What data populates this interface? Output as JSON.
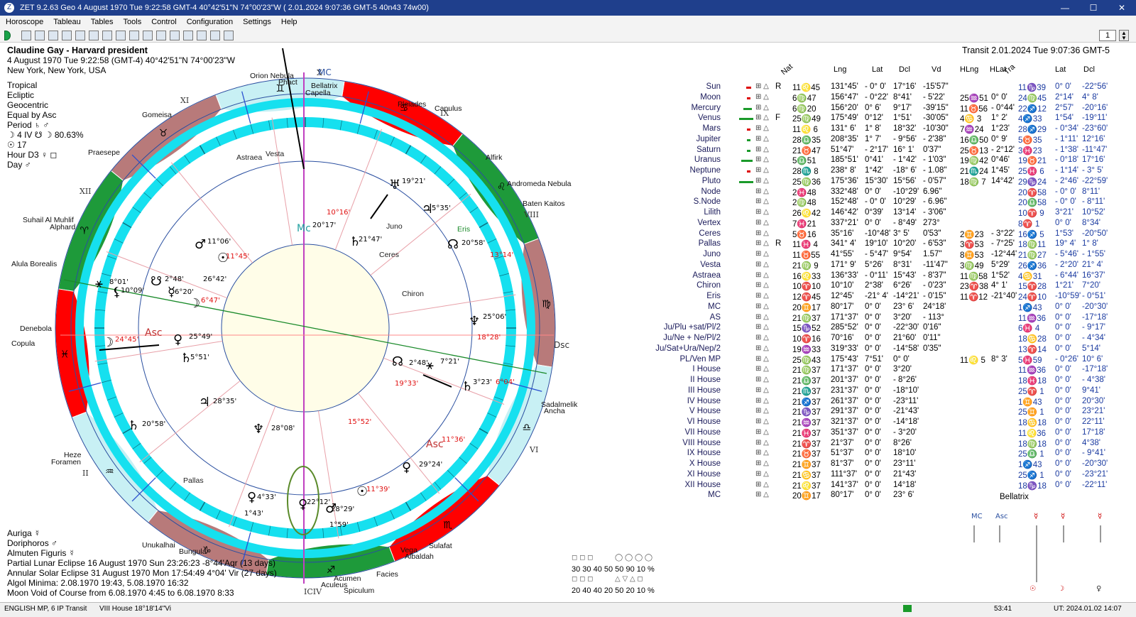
{
  "window": {
    "title": "ZET 9.2.63 Geo    4 August 1970  Tue  9:22:58 GMT-4 40°42'51\"N  74°00'23\"W  ( 2.01.2024   9:07:36 GMT-5 40n43 74w00)"
  },
  "menu": [
    "Horoscope",
    "Tableau",
    "Tables",
    "Tools",
    "Control",
    "Configuration",
    "Settings",
    "Help"
  ],
  "toolbar": {
    "spinner_value": "1"
  },
  "header_left": {
    "name": "Claudine Gay - Harvard president",
    "line2": "4 August 1970  Tue   9:22:58 (GMT-4) 40°42'51\"N  74°00'23\"W",
    "line3": "New York, New York, USA"
  },
  "settings_left": [
    "Tropical",
    "Ecliptic",
    "Geocentric",
    "Equal by Asc",
    "Period  ♄ ♂",
    "☽  4 IV  ☋ ☽ 80.63%",
    "☉  17",
    "Hour D3  ♀ ◻",
    "Day  ♂"
  ],
  "transit_header": "Transit  2.01.2024  Tue  9:07:36 GMT-5",
  "column_headers": {
    "nat": "Nat",
    "lng": "Lng",
    "lat": "Lat",
    "dcl": "Dcl",
    "vd": "Vd",
    "hlng": "HLng",
    "hlat": "HLat",
    "tra": "Tra",
    "tlat": "Lat",
    "tdcl": "Dcl"
  },
  "planets": [
    {
      "name": "Sun",
      "r": "R",
      "pos": "11♌45",
      "lng": "131°45'",
      "lat": "- 0° 0'",
      "dcl": "17°16'",
      "vd": "-15'57\"",
      "hlng": "",
      "hlat": "",
      "tpos": "11♑39",
      "tlat": "0° 0'",
      "tdcl": "-22°56'",
      "bar": "#d00",
      "barw": 18
    },
    {
      "name": "Moon",
      "r": "",
      "pos": "6♍47",
      "lng": "156°47'",
      "lat": "- 0°22'",
      "dcl": "8°41'",
      "vd": "- 5'22'",
      "hlng": "25♒51",
      "hlat": "0° 0'",
      "tpos": "24♍45",
      "tlat": "2°14'",
      "tdcl": "4° 8'",
      "bar": "#d00",
      "barw": 14
    },
    {
      "name": "Mercury",
      "r": "",
      "pos": "6♍20",
      "lng": "156°20'",
      "lat": "0° 6'",
      "dcl": "9°17'",
      "vd": "-39'15\"",
      "hlng": "11♉56",
      "hlat": "- 0°44'",
      "tpos": "22♐12",
      "tlat": "2°57'",
      "tdcl": "-20°16'",
      "bar": "#1a9a2a",
      "barw": 30
    },
    {
      "name": "Venus",
      "r": "F",
      "pos": "25♍49",
      "lng": "175°49'",
      "lat": "0°12'",
      "dcl": "1°51'",
      "vd": "-30'05\"",
      "hlng": "4♋ 3",
      "hlat": "1° 2'",
      "tpos": "4♐33",
      "tlat": "1°54'",
      "tdcl": "-19°11'",
      "bar": "#1a9a2a",
      "barw": 50
    },
    {
      "name": "Mars",
      "r": "",
      "pos": "11♌ 6",
      "lng": "131° 6'",
      "lat": "1° 8'",
      "dcl": "18°32'",
      "vd": "-10'30\"",
      "hlng": "7♒24",
      "hlat": "1°23'",
      "tpos": "28♐29",
      "tlat": "- 0°34'",
      "tdcl": "-23°60'",
      "bar": "#d00",
      "barw": 14
    },
    {
      "name": "Jupiter",
      "r": "",
      "pos": "28♎35",
      "lng": "208°35'",
      "lat": "1° 7'",
      "dcl": "- 9°56'",
      "vd": "- 2'38\"",
      "hlng": "16♎50",
      "hlat": "0° 9'",
      "tpos": "5♉35",
      "tlat": "- 1°11'",
      "tdcl": "12°16'",
      "bar": "#1a9a2a",
      "barw": 14
    },
    {
      "name": "Saturn",
      "r": "",
      "pos": "21♉47",
      "lng": "51°47'",
      "lat": "- 2°17'",
      "dcl": "16° 1'",
      "vd": "0'37\"",
      "hlng": "25♉13",
      "hlat": "- 2°12'",
      "tpos": "3♓23",
      "tlat": "- 1°38'",
      "tdcl": "-11°47'",
      "bar": "#1a9a2a",
      "barw": 14
    },
    {
      "name": "Uranus",
      "r": "",
      "pos": "5♎51",
      "lng": "185°51'",
      "lat": "0°41'",
      "dcl": "- 1°42'",
      "vd": "- 1'03\"",
      "hlng": "19♍42",
      "hlat": "0°46'",
      "tpos": "19♉21",
      "tlat": "- 0°18'",
      "tdcl": "17°16'",
      "bar": "#1a9a2a",
      "barw": 40
    },
    {
      "name": "Neptune",
      "r": "",
      "pos": "28♏ 8",
      "lng": "238° 8'",
      "lat": "1°42'",
      "dcl": "-18° 6'",
      "vd": "- 1.08\"",
      "hlng": "21♏24",
      "hlat": "1°45'",
      "tpos": "25♓ 6",
      "tlat": "- 1°14'",
      "tdcl": "- 3° 5'",
      "bar": "#d00",
      "barw": 14
    },
    {
      "name": "Pluto",
      "r": "",
      "pos": "25♍36",
      "lng": "175°36'",
      "lat": "15°30'",
      "dcl": "15°56'",
      "vd": "- 0'57\"",
      "hlng": "18♍ 7",
      "hlat": "14°42'",
      "tpos": "29♑24",
      "tlat": "- 2°46'",
      "tdcl": "-22°59'",
      "bar": "#1a9a2a",
      "barw": 50
    },
    {
      "name": "Node",
      "r": "",
      "pos": "2♓48",
      "lng": "332°48'",
      "lat": "0° 0'",
      "dcl": "-10°29'",
      "vd": "6.96\"",
      "hlng": "",
      "hlat": "",
      "tpos": "20♈58",
      "tlat": "- 0° 0'",
      "tdcl": "8°11'",
      "bar": "",
      "barw": 0
    },
    {
      "name": "S.Node",
      "r": "",
      "pos": "2♍48",
      "lng": "152°48'",
      "lat": "- 0° 0'",
      "dcl": "10°29'",
      "vd": "- 6.96\"",
      "hlng": "",
      "hlat": "",
      "tpos": "20♎58",
      "tlat": "- 0° 0'",
      "tdcl": "- 8°11'",
      "bar": "",
      "barw": 0
    },
    {
      "name": "Lilith",
      "r": "",
      "pos": "26♌42",
      "lng": "146°42'",
      "lat": "0°39'",
      "dcl": "13°14'",
      "vd": "- 3'06\"",
      "hlng": "",
      "hlat": "",
      "tpos": "10♈ 9",
      "tlat": "3°21'",
      "tdcl": "10°52'",
      "bar": "",
      "barw": 0
    },
    {
      "name": "Vertex",
      "r": "",
      "pos": "7♓21",
      "lng": "337°21'",
      "lat": "0° 0'",
      "dcl": "- 8°49'",
      "vd": "273°",
      "hlng": "",
      "hlat": "",
      "tpos": "8♈ 1",
      "tlat": "0° 0'",
      "tdcl": "8°34'",
      "bar": "",
      "barw": 0
    },
    {
      "name": "Ceres",
      "r": "",
      "pos": "5♉16",
      "lng": "35°16'",
      "lat": "-10°48'",
      "dcl": "3° 5'",
      "vd": "0'53\"",
      "hlng": "2♊23",
      "hlat": "- 3°22'",
      "tpos": "16♐ 5",
      "tlat": "1°53'",
      "tdcl": "-20°50'",
      "bar": "",
      "barw": 0
    },
    {
      "name": "Pallas",
      "r": "R",
      "pos": "11♓ 4",
      "lng": "341° 4'",
      "lat": "19°10'",
      "dcl": "10°20'",
      "vd": "- 6'53\"",
      "hlng": "3♈53",
      "hlat": "- 7°25'",
      "tpos": "18♍11",
      "tlat": "19° 4'",
      "tdcl": "1° 8'",
      "bar": "",
      "barw": 0
    },
    {
      "name": "Juno",
      "r": "",
      "pos": "11♉55",
      "lng": "41°55'",
      "lat": "- 5°47'",
      "dcl": "9°54'",
      "vd": "1.57\"",
      "hlng": "8♊53",
      "hlat": "-12°44'",
      "tpos": "21♍27",
      "tlat": "- 5°46'",
      "tdcl": "- 1°55'",
      "bar": "",
      "barw": 0
    },
    {
      "name": "Vesta",
      "r": "",
      "pos": "21♍ 9",
      "lng": "171° 9'",
      "lat": "5°26'",
      "dcl": "8°31'",
      "vd": "-11'47\"",
      "hlng": "3♍49",
      "hlat": "5°29'",
      "tpos": "26♐36",
      "tlat": "- 2°20'",
      "tdcl": "21° 4'",
      "bar": "",
      "barw": 0
    },
    {
      "name": "Astraea",
      "r": "",
      "pos": "16♌33",
      "lng": "136°33'",
      "lat": "- 0°11'",
      "dcl": "15°43'",
      "vd": "- 8'37\"",
      "hlng": "11♍58",
      "hlat": "1°52'",
      "tpos": "4♋31",
      "tlat": "- 6°44'",
      "tdcl": "16°37'",
      "bar": "",
      "barw": 0
    },
    {
      "name": "Chiron",
      "r": "",
      "pos": "10♈10",
      "lng": "10°10'",
      "lat": "2°38'",
      "dcl": "6°26'",
      "vd": "- 0'23\"",
      "hlng": "23♈38",
      "hlat": "4° 1'",
      "tpos": "15♈28",
      "tlat": "1°21'",
      "tdcl": "7°20'",
      "bar": "",
      "barw": 0
    },
    {
      "name": "Eris",
      "r": "",
      "pos": "12♈45",
      "lng": "12°45'",
      "lat": "-21° 4'",
      "dcl": "-14°21'",
      "vd": "- 0'15\"",
      "hlng": "11♈12",
      "hlat": "-21°40'",
      "tpos": "24♈10",
      "tlat": "-10°59'",
      "tdcl": "- 0°51'",
      "bar": "",
      "barw": 0
    },
    {
      "name": "MC",
      "r": "",
      "pos": "20♊17",
      "lng": "80°17'",
      "lat": "0° 0'",
      "dcl": "23° 6'",
      "vd": "24°18'",
      "hlng": "",
      "hlat": "",
      "tpos": "1♐43",
      "tlat": "0° 0'",
      "tdcl": "-20°30'",
      "bar": "",
      "barw": 0
    },
    {
      "name": "AS",
      "r": "",
      "pos": "21♍37",
      "lng": "171°37'",
      "lat": "0° 0'",
      "dcl": "3°20'",
      "vd": "- 113°",
      "hlng": "",
      "hlat": "",
      "tpos": "11♒36",
      "tlat": "0° 0'",
      "tdcl": "-17°18'",
      "bar": "",
      "barw": 0
    },
    {
      "name": "Ju/Plu +sat/Pl/2",
      "r": "",
      "pos": "15♑52",
      "lng": "285°52'",
      "lat": "0° 0'",
      "dcl": "-22°30'",
      "vd": "0'16\"",
      "hlng": "",
      "hlat": "",
      "tpos": "6♓ 4",
      "tlat": "0° 0'",
      "tdcl": "- 9°17'",
      "bar": "",
      "barw": 0
    },
    {
      "name": "Ju/Ne + Ne/Pl/2",
      "r": "",
      "pos": "10♈16",
      "lng": "70°16'",
      "lat": "0° 0'",
      "dcl": "21°60'",
      "vd": "0'11\"",
      "hlng": "",
      "hlat": "",
      "tpos": "18♋28",
      "tlat": "0° 0'",
      "tdcl": "- 4°34'",
      "bar": "",
      "barw": 0
    },
    {
      "name": "Ju/Sat+Ura/Nep/2",
      "r": "",
      "pos": "19♒33",
      "lng": "319°33'",
      "lat": "0° 0'",
      "dcl": "-14°58'",
      "vd": "0'35\"",
      "hlng": "",
      "hlat": "",
      "tpos": "13♈14",
      "tlat": "0° 0'",
      "tdcl": "5°14'",
      "bar": "",
      "barw": 0
    },
    {
      "name": "PL/Ven MP",
      "r": "",
      "pos": "25♍43",
      "lng": "175°43'",
      "lat": "7°51'",
      "dcl": "0° 0'",
      "vd": "",
      "hlng": "11♌ 5",
      "hlat": "8° 3'",
      "tpos": "5♓59",
      "tlat": "- 0°26'",
      "tdcl": "10° 6'",
      "bar": "",
      "barw": 0
    }
  ],
  "houses": [
    {
      "name": "I House",
      "pos": "21♍37",
      "lng": "171°37'",
      "lat": "0° 0'",
      "dcl": "3°20'",
      "tpos": "11♒36",
      "tlat": "0° 0'",
      "tdcl": "-17°18'"
    },
    {
      "name": "II House",
      "pos": "21♎37",
      "lng": "201°37'",
      "lat": "0° 0'",
      "dcl": "- 8°26'",
      "tpos": "18♓18",
      "tlat": "0° 0'",
      "tdcl": "- 4°38'"
    },
    {
      "name": "III House",
      "pos": "21♏37",
      "lng": "231°37'",
      "lat": "0° 0'",
      "dcl": "-18°10'",
      "tpos": "25♈ 1",
      "tlat": "0° 0'",
      "tdcl": "9°41'"
    },
    {
      "name": "IV House",
      "pos": "21♐37",
      "lng": "261°37'",
      "lat": "0° 0'",
      "dcl": "-23°11'",
      "tpos": "1♊43",
      "tlat": "0° 0'",
      "tdcl": "20°30'"
    },
    {
      "name": "V House",
      "pos": "21♑37",
      "lng": "291°37'",
      "lat": "0° 0'",
      "dcl": "-21°43'",
      "tpos": "25♊ 1",
      "tlat": "0° 0'",
      "tdcl": "23°21'"
    },
    {
      "name": "VI House",
      "pos": "21♒37",
      "lng": "321°37'",
      "lat": "0° 0'",
      "dcl": "-14°18'",
      "tpos": "18♋18",
      "tlat": "0° 0'",
      "tdcl": "22°11'"
    },
    {
      "name": "VII House",
      "pos": "21♓37",
      "lng": "351°37'",
      "lat": "0° 0'",
      "dcl": "- 3°20'",
      "tpos": "11♌36",
      "tlat": "0° 0'",
      "tdcl": "17°18'"
    },
    {
      "name": "VIII House",
      "pos": "21♈37",
      "lng": "21°37'",
      "lat": "0° 0'",
      "dcl": "8°26'",
      "tpos": "18♍18",
      "tlat": "0° 0'",
      "tdcl": "4°38'"
    },
    {
      "name": "IX House",
      "pos": "21♉37",
      "lng": "51°37'",
      "lat": "0° 0'",
      "dcl": "18°10'",
      "tpos": "25♎ 1",
      "tlat": "0° 0'",
      "tdcl": "- 9°41'"
    },
    {
      "name": "X House",
      "pos": "21♊37",
      "lng": "81°37'",
      "lat": "0° 0'",
      "dcl": "23°11'",
      "tpos": "1♐43",
      "tlat": "0° 0'",
      "tdcl": "-20°30'"
    },
    {
      "name": "XI House",
      "pos": "21♋37",
      "lng": "111°37'",
      "lat": "0° 0'",
      "dcl": "21°43'",
      "tpos": "25♐ 1",
      "tlat": "0° 0'",
      "tdcl": "-23°21'"
    },
    {
      "name": "XII House",
      "pos": "21♌37",
      "lng": "141°37'",
      "lat": "0° 0'",
      "dcl": "14°18'",
      "tpos": "18♑18",
      "tlat": "0° 0'",
      "tdcl": "-22°11'"
    },
    {
      "name": "MC",
      "pos": "20♊17",
      "lng": "80°17'",
      "lat": "0° 0'",
      "dcl": "23° 6'",
      "tpos": "",
      "tlat": "",
      "tdcl": ""
    }
  ],
  "fixed_star_bottom": "Bellatrix",
  "bottom_left": [
    "Auriga  ☿",
    "Doriphoros  ♂",
    "Almuten Figuris  ☿",
    "Partial Lunar Eclipse 16 August 1970 Sun 23:26:23 -8°44'Aqr (13 days)",
    "Annular Solar Eclipse 31 August 1970 Mon 17:54:49  4°04' Vir (27 days)",
    "Algol Minima: 2.08.1970 19:43,  5.08.1970 16:32",
    "Moon Void of Course from 6.08.1970  4:45 to 6.08.1970  8:33"
  ],
  "orb_table": {
    "row1": [
      "30",
      "30",
      "40",
      "",
      "50",
      "50",
      "90",
      "10 %"
    ],
    "row2": [
      "20",
      "40",
      "40",
      "",
      "20",
      "50",
      "20",
      "10 %"
    ]
  },
  "status": {
    "left": "ENGLISH MP, 6 IP Transit",
    "mid": "VIII House 18°18'14\"Vi",
    "time": "53:41",
    "right": "UT: 2024.01.02  14:07"
  },
  "wheel": {
    "house_labels": [
      "XI",
      "XII",
      "IX",
      "VIII",
      "VI",
      "II",
      "ICIV",
      "X"
    ],
    "stars": [
      "Orion Nebula",
      "Phact",
      "Bellatrix",
      "Capella",
      "Pleiades",
      "Capulus",
      "Alfirk",
      "Andromeda Nebula",
      "Baten Kaitos",
      "Gomeisa",
      "Praesepe",
      "Suhail Al Muhlif",
      "Alphard",
      "Alula Borealis",
      "Denebola",
      "Copula",
      "Sadalmelik",
      "Ancha",
      "Heze",
      "Foramen",
      "Unukalhai",
      "Bungula",
      "Vega",
      "Albaldah",
      "Sulafat",
      "Facies",
      "Acumen",
      "Aculeus",
      "Spiculum"
    ],
    "asteroids": [
      "Astraea",
      "Vesta",
      "Juno",
      "Ceres",
      "Eris",
      "Chiron",
      "Pallas"
    ],
    "degree_labels": [
      "20°17'",
      "10°16'",
      "19°21'",
      "5°35'",
      "21°47'",
      "11°06'",
      "11°45'",
      "20°58'",
      "13°14'",
      "26°42'",
      "2°48'",
      "6°20'",
      "8°01'",
      "10°09'",
      "6°47'",
      "24°45'",
      "25°49'",
      "5°51'",
      "25°06'",
      "18°28'",
      "7°21'",
      "2°48'",
      "3°23'",
      "6°04'",
      "19°33'",
      "28°35'",
      "15°52'",
      "20°58'",
      "28°08'",
      "11°36'",
      "29°24'",
      "4°33'",
      "1°43'",
      "22°12'",
      "28°29'",
      "11°39'",
      "1°59'"
    ],
    "axis_labels": [
      "MC",
      "Asc",
      "Dsc",
      "Asc",
      "Mc"
    ]
  }
}
